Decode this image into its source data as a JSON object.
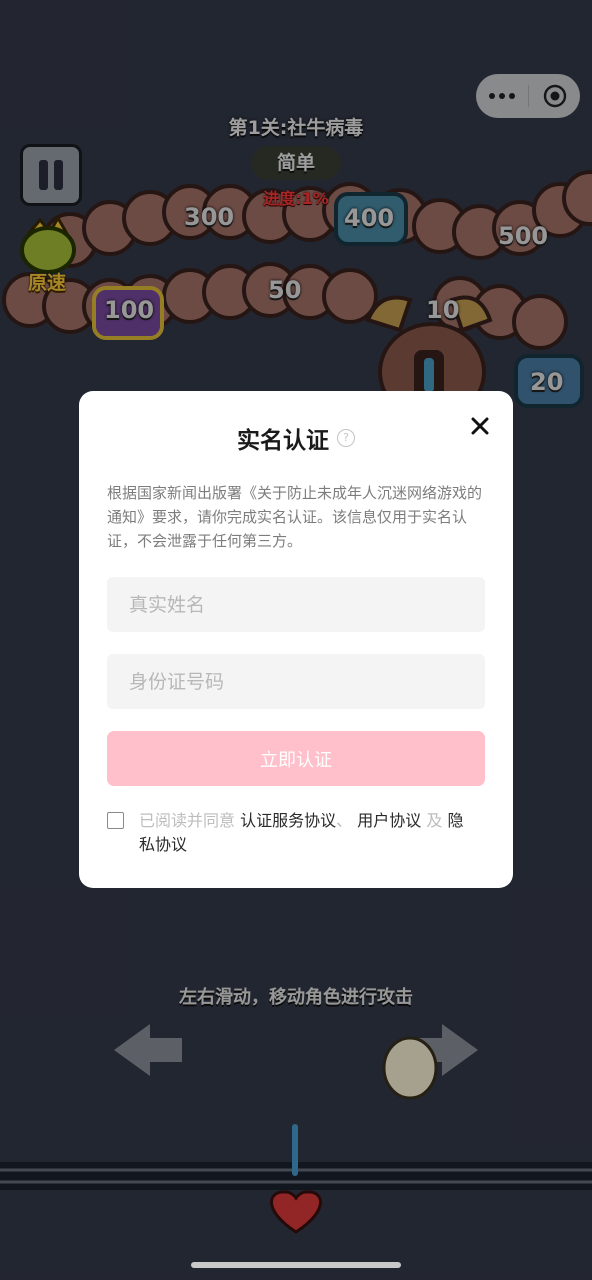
{
  "game": {
    "level_title": "第1关:社牛病毒",
    "difficulty": "简单",
    "progress": "进度:1%",
    "speed_label": "原速",
    "numbers": [
      "300",
      "400",
      "500",
      "100",
      "50",
      "10",
      "20"
    ],
    "hint": "左右滑动，移动角色进行攻击"
  },
  "dialog": {
    "title": "实名认证",
    "help_icon_glyph": "?",
    "description": "根据国家新闻出版署《关于防止未成年人沉迷网络游戏的通知》要求，请你完成实名认证。该信息仅用于实名认证，不会泄露于任何第三方。",
    "name_placeholder": "真实姓名",
    "id_placeholder": "身份证号码",
    "submit_label": "立即认证",
    "agree_prefix": "已阅读并同意",
    "agree_link_1": "认证服务协议",
    "agree_sep_1": "、",
    "agree_link_2": "用户协议",
    "agree_sep_2": "及",
    "agree_link_3": "隐私协议"
  },
  "colors": {
    "submit_bg": "#ffc0cb",
    "progress": "#ff3b3b",
    "speed": "#ffcf3a"
  }
}
